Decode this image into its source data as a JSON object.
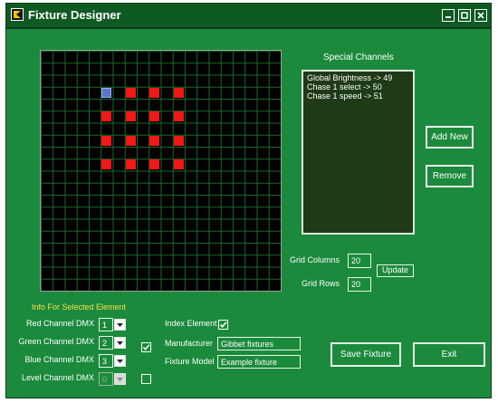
{
  "window": {
    "title": "Fixture Designer"
  },
  "titlebar": {
    "min_icon": "minimize-icon",
    "max_icon": "maximize-icon",
    "close_icon": "close-icon"
  },
  "grid": {
    "columns": 20,
    "rows": 20,
    "selected_color": "#5a74c6",
    "element_color": "#f01818",
    "elements": [
      {
        "col": 5,
        "row": 3,
        "selected": true
      },
      {
        "col": 7,
        "row": 3
      },
      {
        "col": 9,
        "row": 3
      },
      {
        "col": 11,
        "row": 3
      },
      {
        "col": 5,
        "row": 5
      },
      {
        "col": 7,
        "row": 5
      },
      {
        "col": 9,
        "row": 5
      },
      {
        "col": 11,
        "row": 5
      },
      {
        "col": 5,
        "row": 7
      },
      {
        "col": 7,
        "row": 7
      },
      {
        "col": 9,
        "row": 7
      },
      {
        "col": 11,
        "row": 7
      },
      {
        "col": 5,
        "row": 9
      },
      {
        "col": 7,
        "row": 9
      },
      {
        "col": 9,
        "row": 9
      },
      {
        "col": 11,
        "row": 9
      }
    ]
  },
  "special_channels": {
    "heading": "Special Channels",
    "items": [
      "Global Brightness -> 49",
      "Chase 1 select -> 50",
      "Chase 1 speed -> 51"
    ],
    "add_label": "Add New",
    "remove_label": "Remove"
  },
  "grid_settings": {
    "columns_label": "Grid Columns",
    "columns_value": "20",
    "rows_label": "Grid Rows",
    "rows_value": "20",
    "update_label": "Update"
  },
  "selected_element": {
    "heading": "Info For Selected Element",
    "red_label": "Red Channel DMX",
    "red_value": "1",
    "green_label": "Green Channel DMX",
    "green_value": "2",
    "blue_label": "Blue Channel DMX",
    "blue_value": "3",
    "level_label": "Level Channel DMX",
    "level_value": "0",
    "rgb_checked": true,
    "level_checked": false,
    "index_label": "Index Element",
    "index_checked": true,
    "manufacturer_label": "Manufacturer",
    "manufacturer_value": "Gibbet fixtures",
    "model_label": "Fixture Model",
    "model_value": "Example fixture"
  },
  "actions": {
    "save_label": "Save Fixture",
    "exit_label": "Exit"
  }
}
